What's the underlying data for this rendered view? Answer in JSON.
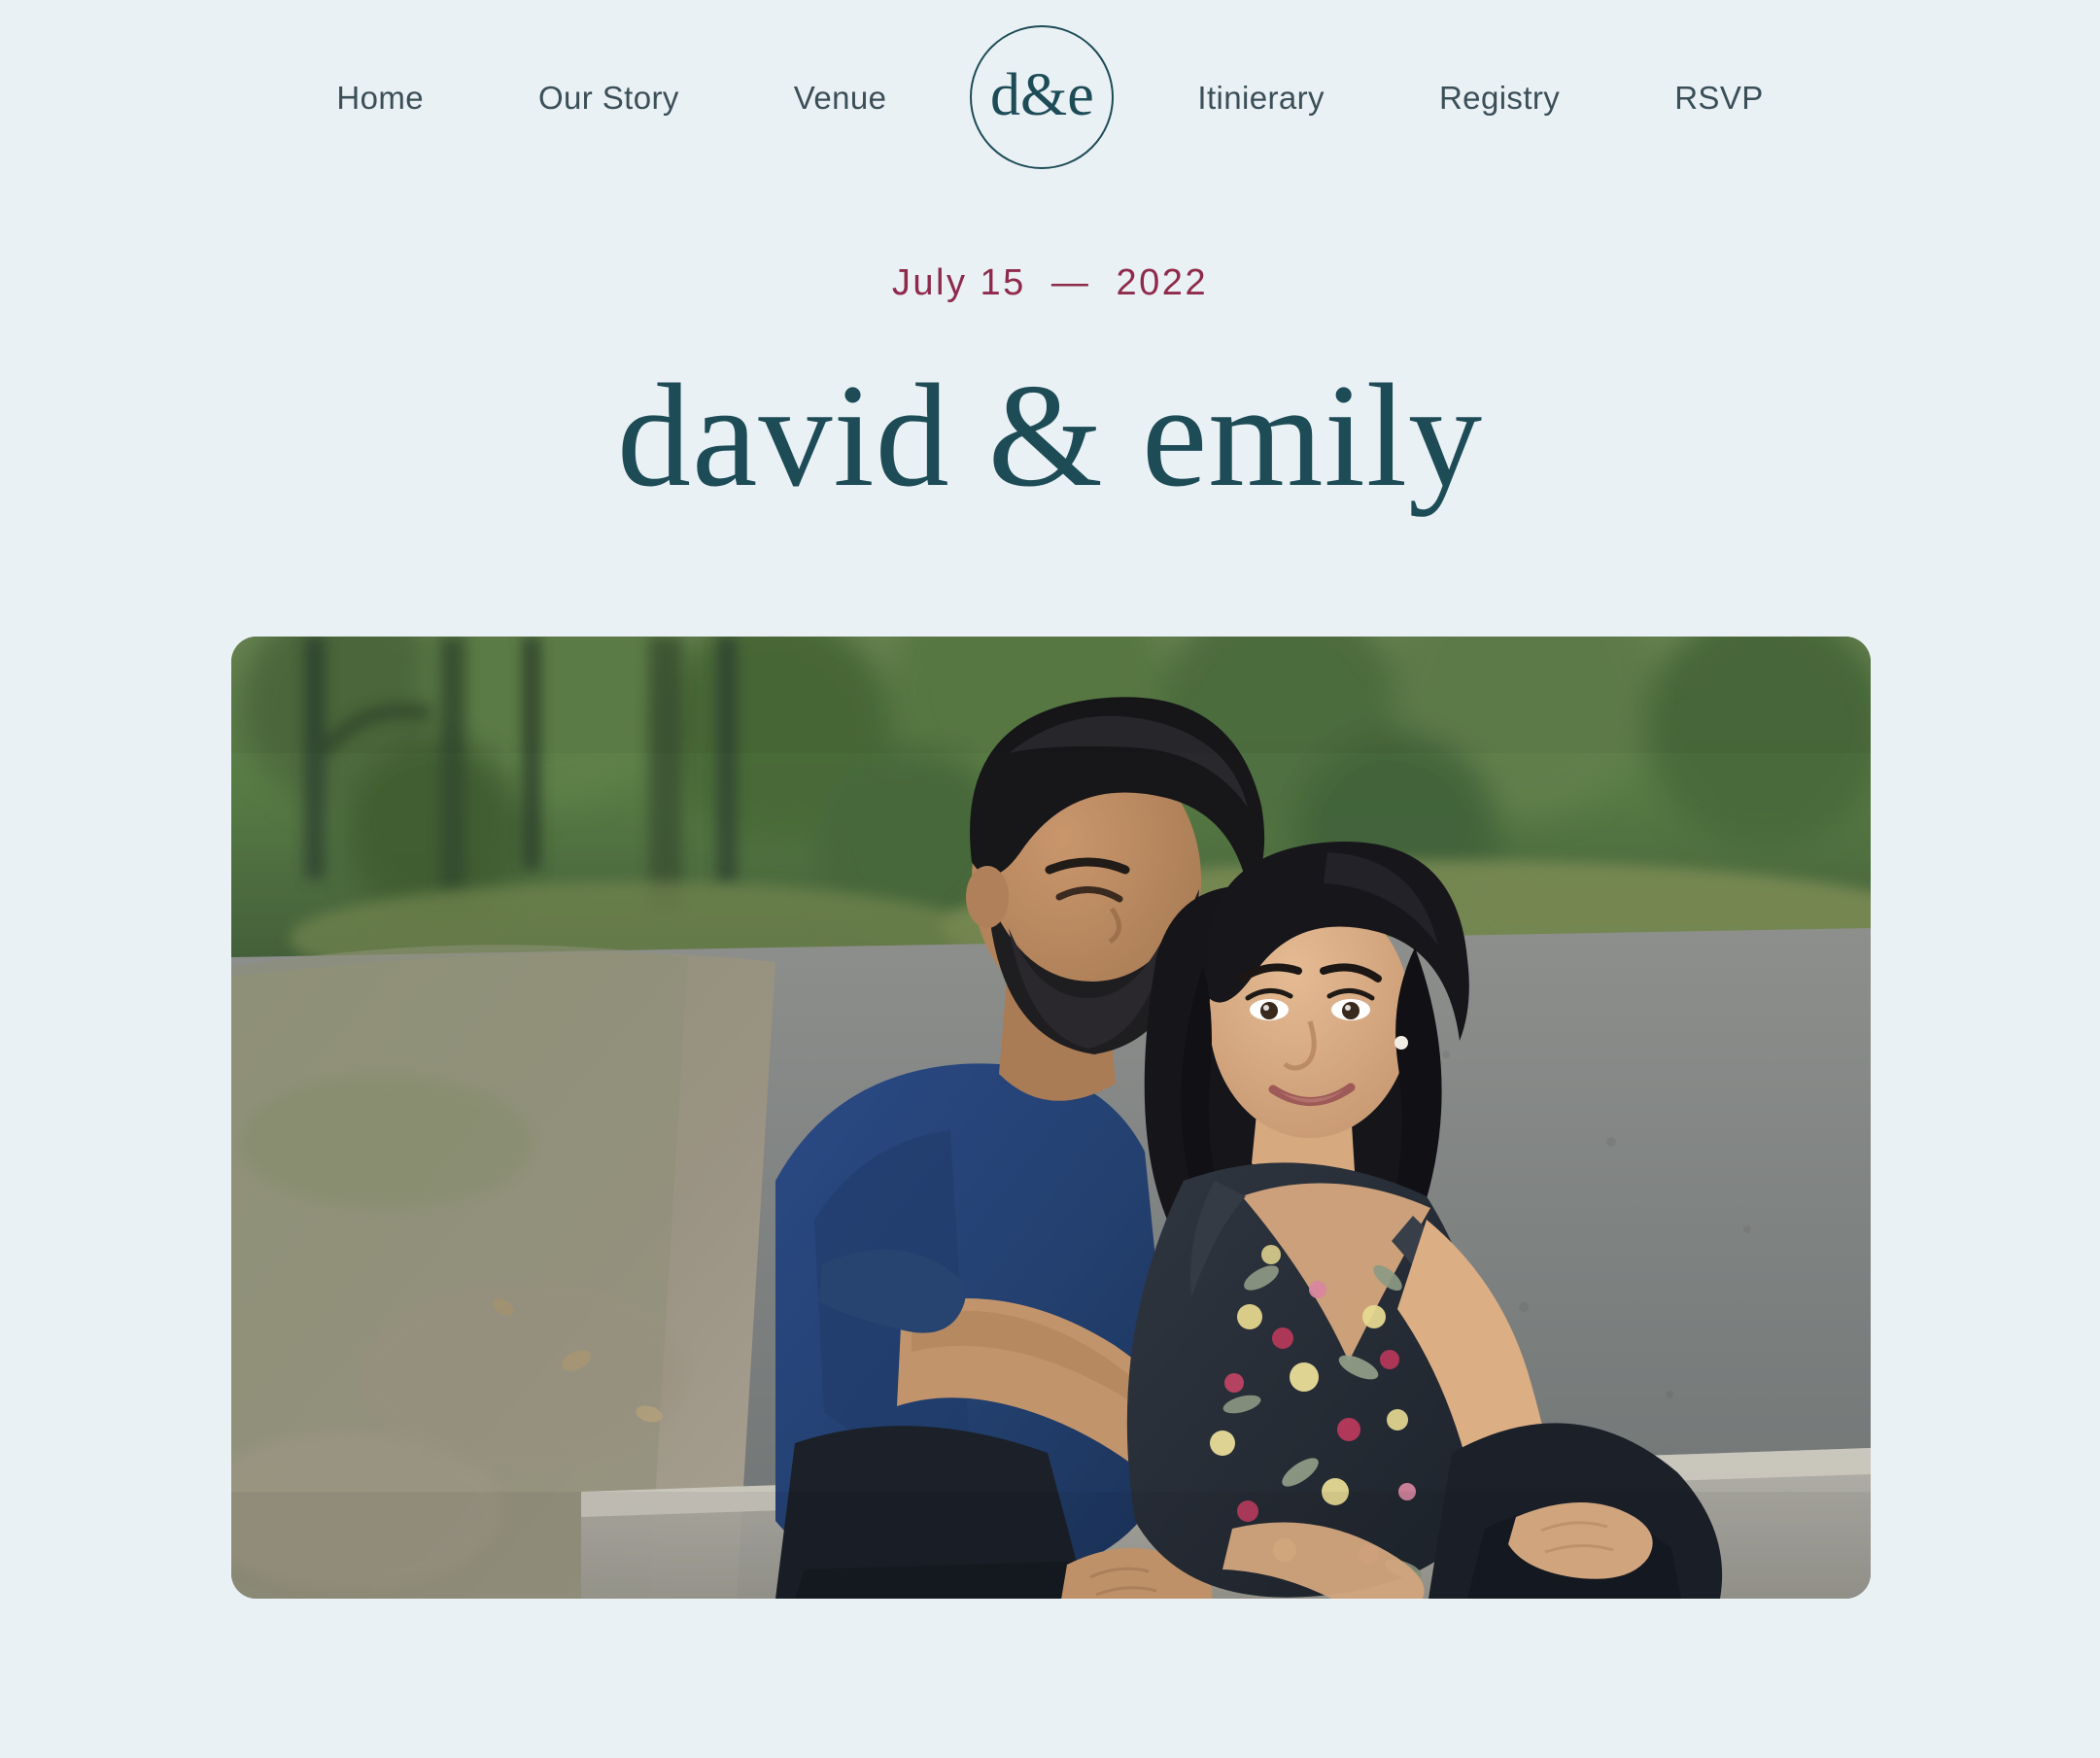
{
  "site": {
    "background_color": "#eaf1f5",
    "accent_teal": "#1d4c57",
    "accent_burgundy": "#8e2a4a",
    "nav_text_color": "#3b4f58"
  },
  "nav": {
    "left_items": [
      {
        "label": "Home"
      },
      {
        "label": "Our Story"
      },
      {
        "label": "Venue"
      }
    ],
    "right_items": [
      {
        "label": "Itinierary"
      },
      {
        "label": "Registry"
      },
      {
        "label": "RSVP"
      }
    ],
    "logo": {
      "monogram": "d&e",
      "shape": "circle-outline"
    }
  },
  "hero": {
    "date": "July 15  —  2022",
    "names": "david & emily",
    "photo": {
      "alt": "Engagement photo of a couple sitting on a curb along a paved park path; the man in a blue linen shirt embraces the woman in a dark floral dress, with green trees and grass behind them.",
      "corner_radius_px": 26
    }
  }
}
